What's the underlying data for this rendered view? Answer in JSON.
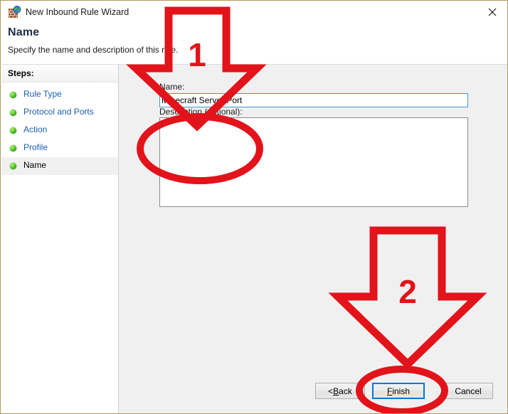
{
  "window": {
    "title": "New Inbound Rule Wizard",
    "icon": "firewall-globe-icon",
    "close_label": "✕",
    "border_color": "#b8985a"
  },
  "header": {
    "title": "Name",
    "subtitle": "Specify the name and description of this rule."
  },
  "sidebar": {
    "title": "Steps:",
    "items": [
      {
        "label": "Rule Type",
        "state": "done"
      },
      {
        "label": "Protocol and Ports",
        "state": "done"
      },
      {
        "label": "Action",
        "state": "done"
      },
      {
        "label": "Profile",
        "state": "done"
      },
      {
        "label": "Name",
        "state": "current"
      }
    ],
    "link_color": "#1a5fb4",
    "current_color": "#000000"
  },
  "form": {
    "name_label_accel": "N",
    "name_label_rest": "ame:",
    "name_value": "Minecraft Server Port",
    "name_placeholder": "",
    "description_label": "Description (optional):",
    "description_value": "",
    "description_placeholder": ""
  },
  "footer": {
    "back": {
      "prefix": "< ",
      "accel": "B",
      "rest": "ack"
    },
    "finish": {
      "accel": "F",
      "rest": "inish"
    },
    "cancel": {
      "label": "Cancel"
    }
  },
  "annotations": {
    "color": "#e2131a",
    "arrow1_number": "1",
    "arrow2_number": "2",
    "ellipse1_target": "name-input",
    "ellipse2_target": "finish-button"
  }
}
